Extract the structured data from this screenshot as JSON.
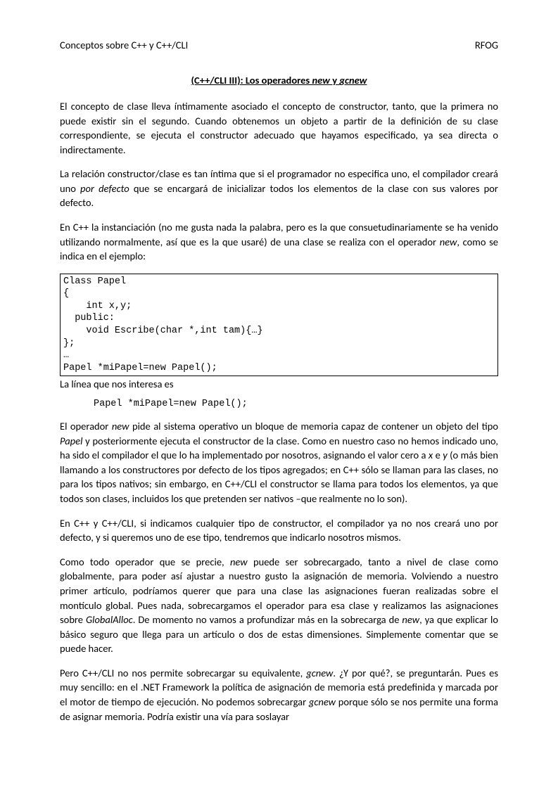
{
  "header": {
    "left": "Conceptos sobre C++ y C++/CLI",
    "right": "RFOG"
  },
  "title": {
    "prefix": "(C++/CLI III): Los operadores ",
    "em1": "new",
    "mid": " y ",
    "em2": "gcnew"
  },
  "para1": "El concepto de clase lleva íntimamente asociado el concepto de constructor, tanto, que la primera no puede existir sin el segundo. Cuando obtenemos un objeto a partir de la definición de su clase correspondiente, se ejecuta el constructor adecuado que hayamos especificado, ya sea directa o indirectamente.",
  "para2": {
    "a": "La relación constructor/clase es tan íntima que si el programador no especifica uno, el compilador creará uno ",
    "em": "por defecto",
    "b": " que se encargará de inicializar todos los elementos de la clase con sus valores por defecto."
  },
  "para3": {
    "a": "En C++ la instanciación (no me gusta nada la palabra, pero es la que consuetudinariamente se ha venido utilizando normalmente, así que es la que usaré) de una clase se realiza con el operador ",
    "em": "new",
    "b": ", como se indica en el ejemplo:"
  },
  "codebox": "Class Papel\n{\n    int x,y;\n  public:\n    void Escribe(char *,int tam){…}\n};\n…\nPapel *miPapel=new Papel();",
  "aftercode": "La línea que nos interesa es",
  "inlinecode": "Papel *miPapel=new Papel();",
  "para4": {
    "a": "El operador  ",
    "em1": "new",
    "b": " pide al sistema operativo un bloque de memoria capaz de contener un objeto del tipo ",
    "em2": "Papel",
    "c": " y posteriormente ejecuta el constructor de la clase. Como en nuestro caso no hemos indicado uno, ha sido el compilador el que lo ha implementado por nosotros, asignando el valor cero a ",
    "em3": "x",
    "d": " e ",
    "em4": "y",
    "e": " (o más bien llamando a los constructores por defecto de los tipos agregados; en C++ sólo se llaman para las clases, no para los tipos nativos; sin embargo, en C++/CLI el constructor se llama para todos los elementos, ya que todos son clases, incluidos los que pretenden ser nativos –que realmente no lo son)."
  },
  "para5": "En C++ y C++/CLI, si indicamos cualquier tipo de constructor, el compilador ya no nos creará uno por defecto, y si queremos uno de ese tipo, tendremos que indicarlo nosotros mismos.",
  "para6": {
    "a": "Como todo operador que se precie, ",
    "em1": "new",
    "b": " puede ser sobrecargado, tanto a nivel de clase como globalmente, para poder así ajustar a nuestro gusto la asignación de memoria. Volviendo a nuestro primer artículo, podríamos querer que para una clase las asignaciones fueran realizadas sobre el montículo global. Pues nada, sobrecargamos el operador para esa clase y realizamos las asignaciones sobre ",
    "em2": "GlobalAlloc",
    "c": ". De momento no vamos a profundizar más en la sobrecarga de ",
    "em3": "new",
    "d": ", ya que explicar lo básico seguro que llega para un artículo o dos de estas dimensiones. Simplemente comentar que se puede hacer."
  },
  "para7": {
    "a": "Pero C++/CLI no nos permite sobrecargar su equivalente, ",
    "em1": "gcnew",
    "b": ". ¿Y por qué?, se preguntarán. Pues es muy sencillo: en el .NET Framework la política de asignación de memoria está predefinida y marcada por el motor de tiempo de ejecución. No podemos sobrecargar ",
    "em2": "gcnew",
    "c": " porque sólo se nos permite una forma de asignar memoria. Podría existir una vía para soslayar"
  }
}
